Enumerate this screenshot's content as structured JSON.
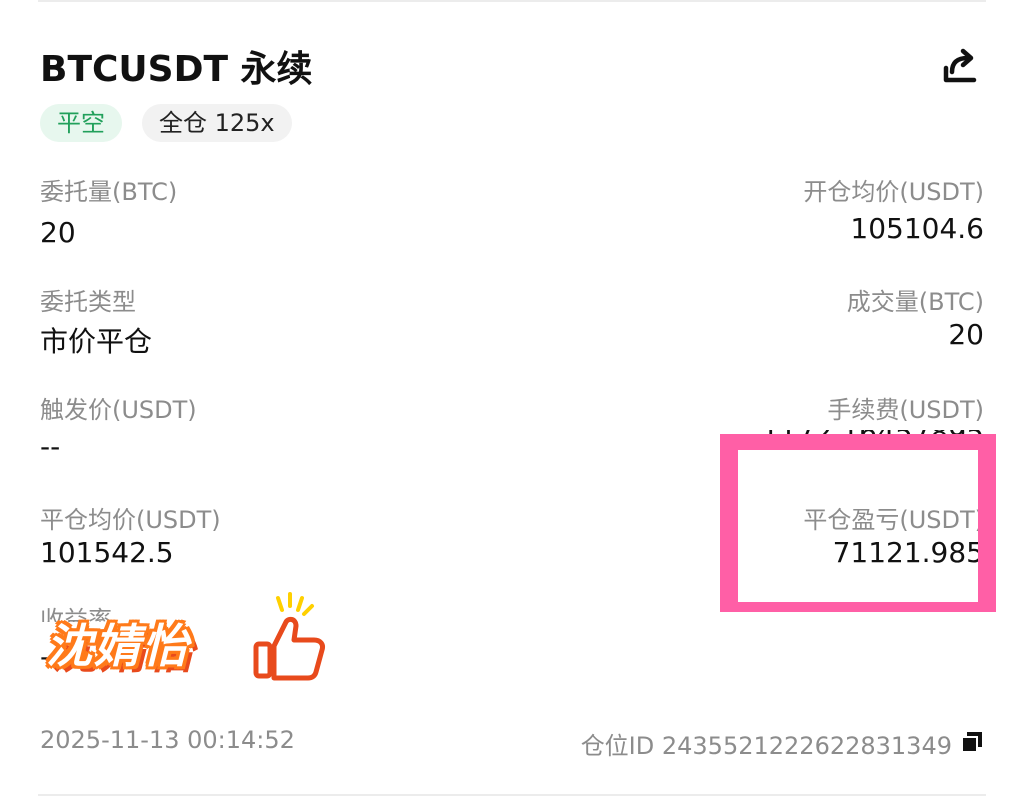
{
  "header": {
    "title": "BTCUSDT 永续",
    "share_icon": "share-icon"
  },
  "tags": {
    "side": "平空",
    "margin_leverage": "全仓 125x"
  },
  "fields": {
    "order_qty_label": "委托量(BTC)",
    "order_qty_value": "20",
    "open_avg_label": "开仓均价(USDT)",
    "open_avg_value": "105104.6",
    "order_type_label": "委托类型",
    "order_type_value": "市价平仓",
    "filled_qty_label": "成交量(BTC)",
    "filled_qty_value": "20",
    "trigger_price_label": "触发价(USDT)",
    "trigger_price_value": "--",
    "fee_label": "手续费(USDT)",
    "close_avg_label": "平仓均价(USDT)",
    "close_avg_value": "101542.5",
    "close_pnl_label": "平仓盈亏(USDT)",
    "close_pnl_value": "71121.985",
    "partial_label": "收益率",
    "partial_value": "-"
  },
  "watermark": {
    "text": "沈婧怡",
    "icon": "thumbs-up-icon"
  },
  "footer": {
    "timestamp": "2025-11-13 00:14:52",
    "position_id": "仓位ID 2435521222622831349",
    "copy_icon": "copy-icon"
  },
  "colors": {
    "green_text": "#21a05b",
    "green_bg": "#e7f7ee",
    "highlight": "#ff5fa6",
    "watermark_orange": "#ff7a1a"
  }
}
